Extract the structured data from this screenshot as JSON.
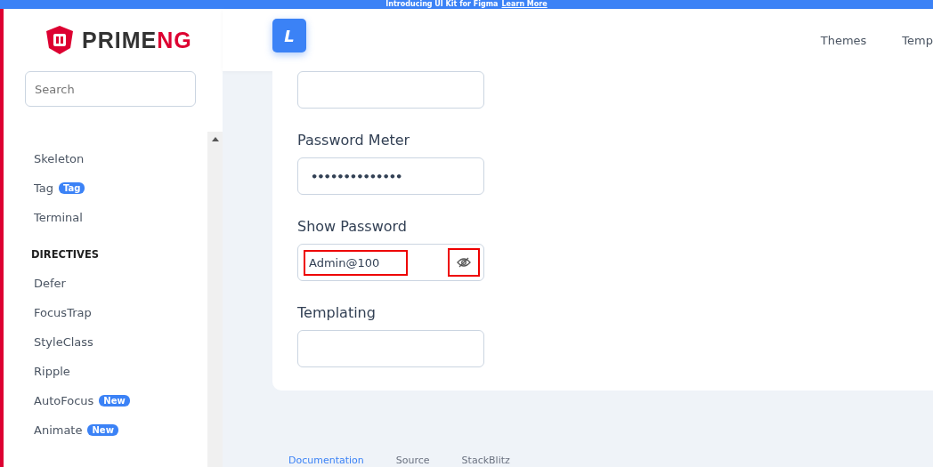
{
  "banner": {
    "text": "Introducing UI Kit for Figma",
    "link": "Learn More"
  },
  "logo": {
    "prime": "PRIME",
    "ng": "NG"
  },
  "app_badge": "L",
  "nav": [
    "Themes",
    "Temp"
  ],
  "search": {
    "placeholder": "Search"
  },
  "sidebar": [
    {
      "kind": "item",
      "label": "Skeleton"
    },
    {
      "kind": "item",
      "label": "Tag",
      "badge": "Tag"
    },
    {
      "kind": "item",
      "label": "Terminal"
    },
    {
      "kind": "header",
      "label": "DIRECTIVES"
    },
    {
      "kind": "item",
      "label": "Defer"
    },
    {
      "kind": "item",
      "label": "FocusTrap"
    },
    {
      "kind": "item",
      "label": "StyleClass"
    },
    {
      "kind": "item",
      "label": "Ripple"
    },
    {
      "kind": "item",
      "label": "AutoFocus",
      "badge": "New"
    },
    {
      "kind": "item",
      "label": "Animate",
      "badge": "New"
    }
  ],
  "fields": [
    {
      "kind": "text"
    },
    {
      "label": "Password Meter",
      "kind": "masked",
      "value": "••••••••••••••"
    },
    {
      "label": "Show Password",
      "kind": "reveal",
      "value": "Admin@100",
      "highlighted": true
    },
    {
      "label": "Templating",
      "kind": "text"
    }
  ],
  "tabs": [
    {
      "label": "Documentation",
      "selected": true
    },
    {
      "label": "Source",
      "selected": false
    },
    {
      "label": "StackBlitz",
      "selected": false
    }
  ]
}
